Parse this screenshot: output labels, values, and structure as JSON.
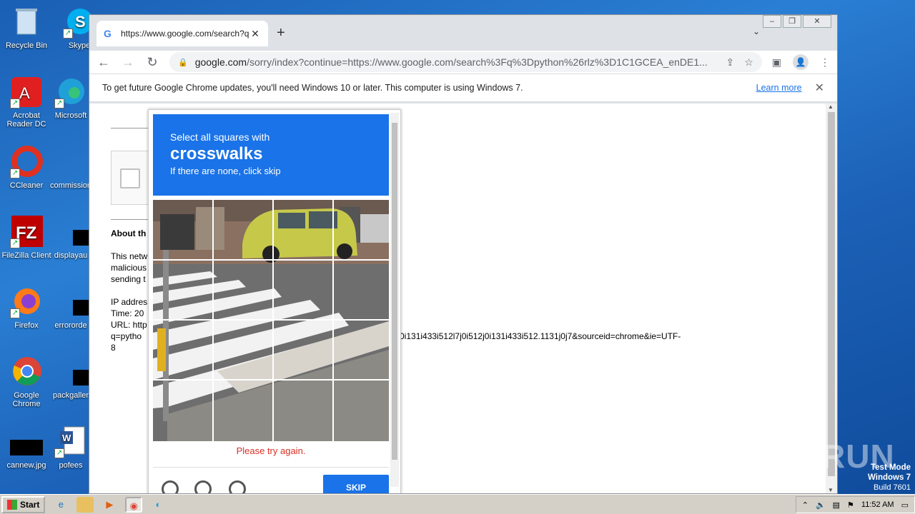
{
  "desktop": {
    "icons": [
      {
        "label": "Recycle Bin"
      },
      {
        "label": "Skype"
      },
      {
        "label": "Acrobat Reader DC"
      },
      {
        "label": "Microsoft"
      },
      {
        "label": "CCleaner"
      },
      {
        "label": "commission"
      },
      {
        "label": "FileZilla Client"
      },
      {
        "label": "displayau"
      },
      {
        "label": "Firefox"
      },
      {
        "label": "errororde"
      },
      {
        "label": "Google Chrome"
      },
      {
        "label": "packgaller"
      },
      {
        "label": "cannew.jpg"
      },
      {
        "label": "pofees"
      }
    ]
  },
  "browser": {
    "tab_title": "https://www.google.com/search?q=",
    "url_host": "google.com",
    "url_rest": "/sorry/index?continue=https://www.google.com/search%3Fq%3Dpython%26rlz%3D1C1GCEA_enDE1...",
    "infobar_message": "To get future Google Chrome updates, you'll need Windows 10 or later. This computer is using Windows 7.",
    "infobar_link": "Learn more"
  },
  "page": {
    "about_heading": "About th",
    "para1": [
      "This netw",
      "malicious",
      "sending t"
    ],
    "ip_lines": [
      "IP addres",
      "Time: 20",
      "URL: http"
    ],
    "query_line_start": "q=pytho",
    "query_line_end": "0i131i433i512l7j0i512j0i131i433i512.1131j0j7&sourceid=chrome&ie=UTF-",
    "query_line_wrap": "8"
  },
  "captcha": {
    "line1": "Select all squares with",
    "line2": "crosswalks",
    "line3": "If there are none, click skip",
    "error": "Please try again.",
    "skip_label": "SKIP"
  },
  "taskbar": {
    "start_label": "Start",
    "clock": "11:52 AM"
  },
  "watermark": "ANY RUN",
  "test_mode": {
    "line1": "Test Mode",
    "line2": "Windows 7",
    "line3": "Build 7601"
  }
}
